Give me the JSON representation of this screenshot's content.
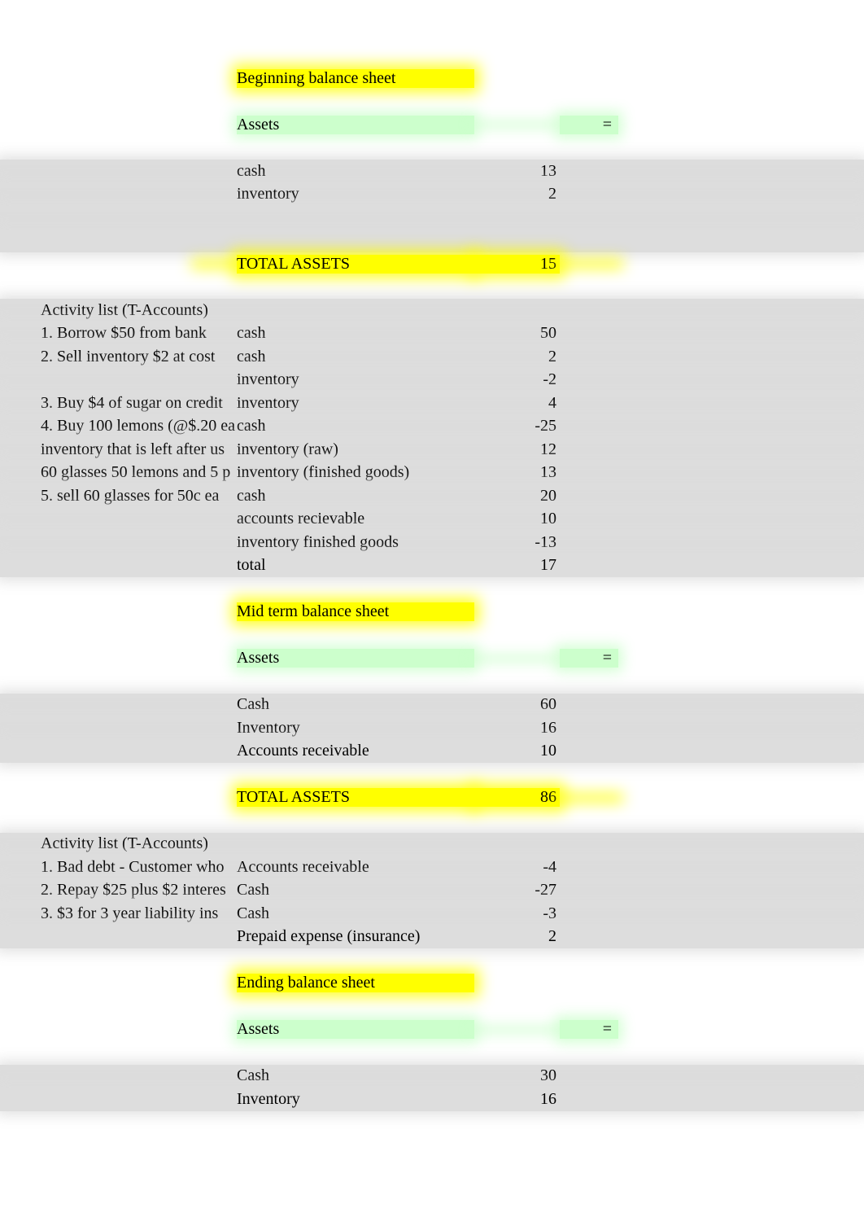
{
  "beginning": {
    "title": "Beginning balance sheet",
    "assetsHeader": "Assets",
    "eq": "=",
    "items": [
      {
        "label": "cash",
        "value": "13"
      },
      {
        "label": "inventory",
        "value": "2"
      }
    ],
    "totalLabel": "TOTAL ASSETS",
    "totalValue": "15"
  },
  "activities1": {
    "header": "Activity list (T-Accounts)",
    "rows": [
      {
        "desc": "1. Borrow $50 from bank",
        "account": "cash",
        "value": "50"
      },
      {
        "desc": "2. Sell inventory $2 at cost",
        "account": "cash",
        "value": "2"
      },
      {
        "desc": "",
        "account": "inventory",
        "value": "-2"
      },
      {
        "desc": "3. Buy $4 of sugar on credit",
        "account": "inventory",
        "value": "4"
      },
      {
        "desc": "4. Buy 100 lemons (@$.20 ea",
        "account": "cash",
        "value": "-25"
      },
      {
        "desc": "inventory that is left after us",
        "account": "inventory (raw)",
        "value": "12"
      },
      {
        "desc": "60 glasses 50 lemons and 5 p",
        "account": "inventory (finished goods)",
        "value": "13"
      },
      {
        "desc": "5. sell 60 glasses for 50c ea",
        "account": "cash",
        "value": "20"
      },
      {
        "desc": "",
        "account": "accounts recievable",
        "value": "10"
      },
      {
        "desc": "",
        "account": "inventory finished goods",
        "value": "-13"
      },
      {
        "desc": "",
        "account": "total",
        "value": "17"
      }
    ]
  },
  "mid": {
    "title": "Mid term balance sheet",
    "assetsHeader": "Assets",
    "eq": "=",
    "items": [
      {
        "label": "Cash",
        "value": "60"
      },
      {
        "label": "Inventory",
        "value": "16"
      },
      {
        "label": "Accounts receivable",
        "value": "10"
      }
    ],
    "totalLabel": "TOTAL ASSETS",
    "totalValue": "86"
  },
  "activities2": {
    "header": "Activity list (T-Accounts)",
    "rows": [
      {
        "desc": "1. Bad debt - Customer who ",
        "account": "Accounts receivable",
        "value": "-4"
      },
      {
        "desc": "2. Repay $25 plus $2 interes",
        "account": "Cash",
        "value": "-27"
      },
      {
        "desc": "3. $3 for 3 year liability ins",
        "account": "Cash",
        "value": "-3"
      },
      {
        "desc": "",
        "account": "Prepaid expense (insurance)",
        "value": "2"
      }
    ]
  },
  "ending": {
    "title": "Ending balance sheet",
    "assetsHeader": "Assets",
    "eq": "=",
    "items": [
      {
        "label": "Cash",
        "value": "30"
      },
      {
        "label": "Inventory",
        "value": "16"
      }
    ]
  }
}
